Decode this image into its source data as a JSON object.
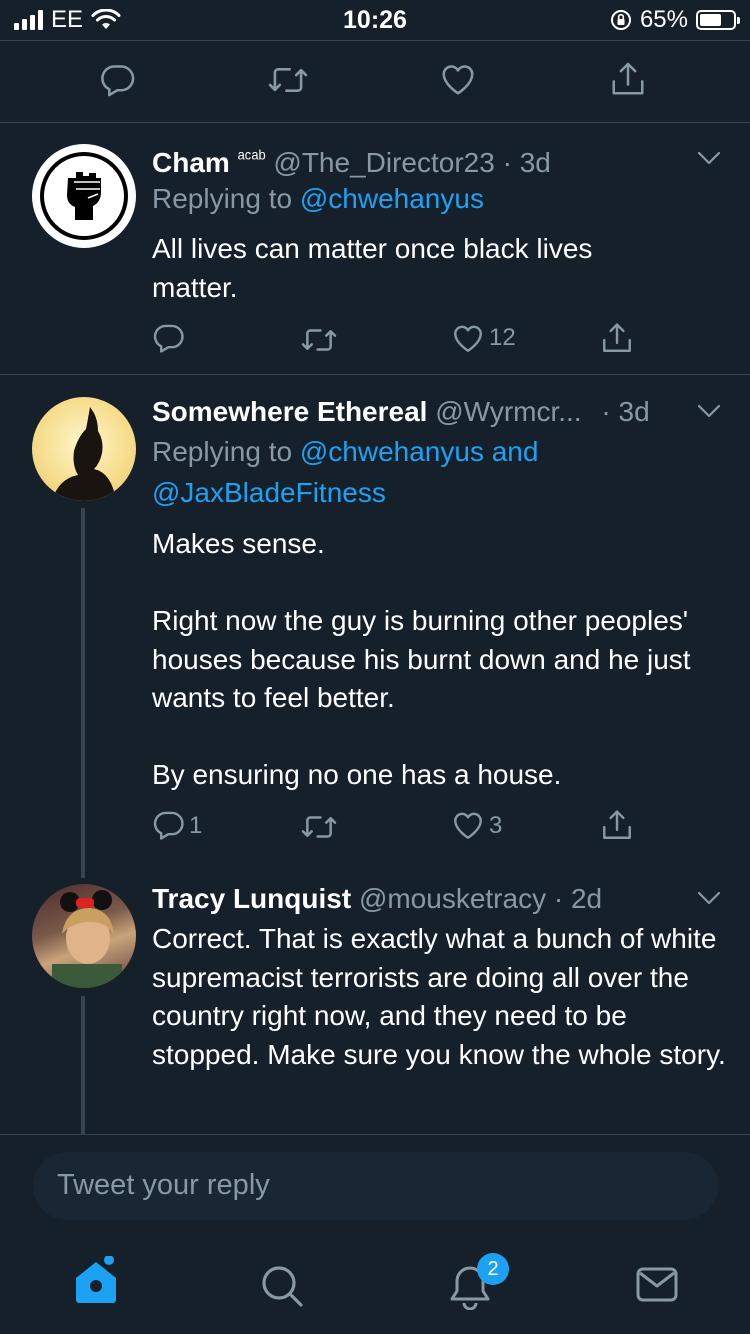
{
  "status_bar": {
    "carrier": "EE",
    "time": "10:26",
    "battery_percent": "65%",
    "battery_level": 0.65
  },
  "top_actions": [
    "reply-icon",
    "retweet-icon",
    "like-icon",
    "share-icon"
  ],
  "tweets": [
    {
      "display_name": "Cham",
      "name_suffix": "ᵃᶜᵃᵇ",
      "handle": "@The_Director23",
      "time": "· 3d",
      "replying_label": "Replying to",
      "replying_to": "@chwehanyus",
      "text": "All lives can matter once black lives matter.",
      "reply_count": "",
      "retweet_count": "",
      "like_count": "12"
    },
    {
      "display_name": "Somewhere Ethereal",
      "handle": "@Wyrmcr...",
      "time": "· 3d",
      "replying_label": "Replying to",
      "replying_to": "@chwehanyus and",
      "replying_to_2": "@JaxBladeFitness",
      "text_lines": [
        "Makes sense.",
        "",
        "Right now the guy is burning other peoples' houses because his burnt down and he just wants to feel better.",
        "",
        "By ensuring no one has a house."
      ],
      "reply_count": "1",
      "retweet_count": "",
      "like_count": "3"
    },
    {
      "display_name": "Tracy Lunquist",
      "handle": "@mousketracy",
      "time": "· 2d",
      "text": "Correct. That is exactly what a bunch of white supremacist terrorists are doing all over the country right now, and they need to be stopped. Make sure you know the whole story."
    }
  ],
  "reply_input": {
    "placeholder": "Tweet your reply"
  },
  "tab_bar": {
    "items": [
      "home-icon",
      "search-icon",
      "notifications-icon",
      "messages-icon"
    ],
    "notifications_badge": "2"
  },
  "colors": {
    "background": "#15202b",
    "accent": "#1da1f2",
    "muted": "#8899a6",
    "divider": "#38444d"
  }
}
